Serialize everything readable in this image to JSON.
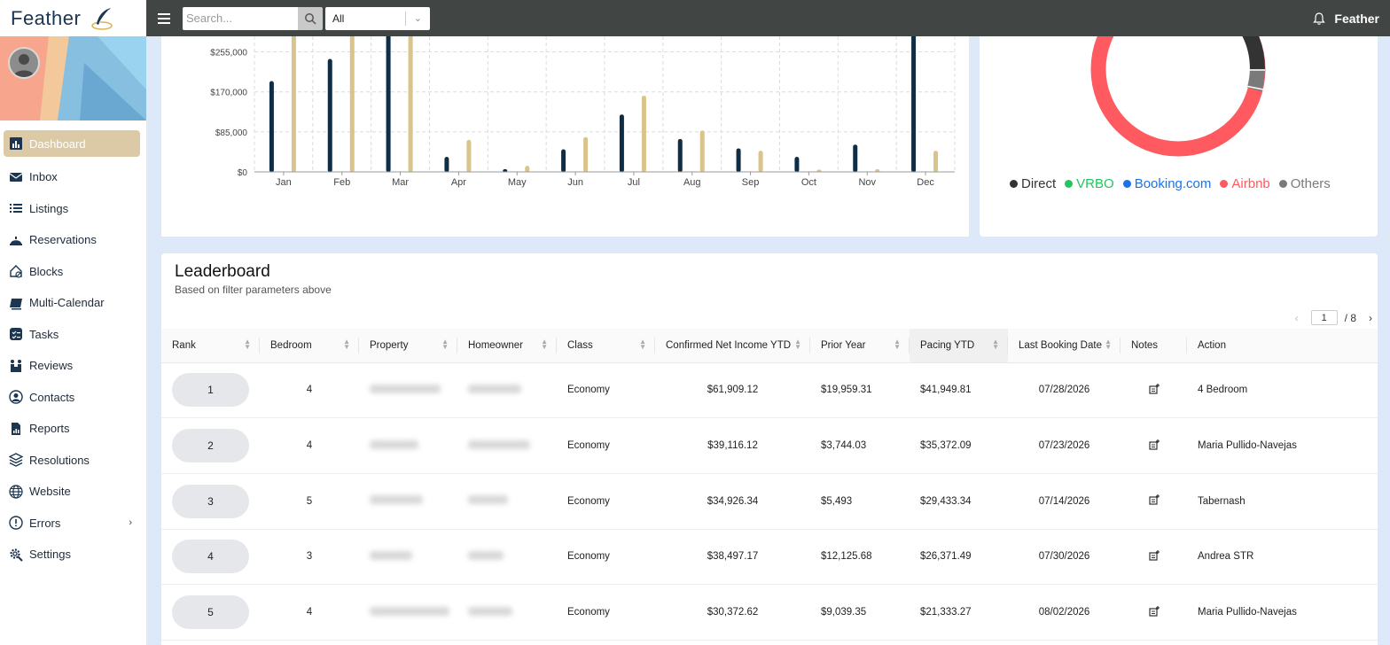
{
  "brand": {
    "name": "Feather"
  },
  "search": {
    "placeholder": "Search...",
    "filter_value": "All"
  },
  "topbar": {
    "user": "Feather"
  },
  "sidebar": {
    "items": [
      {
        "label": "Dashboard",
        "icon": "bar-chart-icon",
        "active": true
      },
      {
        "label": "Inbox",
        "icon": "envelope-icon"
      },
      {
        "label": "Listings",
        "icon": "list-icon"
      },
      {
        "label": "Reservations",
        "icon": "service-bell-icon"
      },
      {
        "label": "Blocks",
        "icon": "house-block-icon"
      },
      {
        "label": "Multi-Calendar",
        "icon": "calendar-icon"
      },
      {
        "label": "Tasks",
        "icon": "tasks-icon"
      },
      {
        "label": "Reviews",
        "icon": "reviews-icon"
      },
      {
        "label": "Contacts",
        "icon": "contact-icon"
      },
      {
        "label": "Reports",
        "icon": "report-icon"
      },
      {
        "label": "Resolutions",
        "icon": "layers-icon"
      },
      {
        "label": "Website",
        "icon": "globe-icon"
      },
      {
        "label": "Errors",
        "icon": "alert-circle-icon",
        "expandable": true
      },
      {
        "label": "Settings",
        "icon": "gear-icon"
      }
    ]
  },
  "chart_data": {
    "type": "bar",
    "categories": [
      "Jan",
      "Feb",
      "Mar",
      "Apr",
      "May",
      "Jun",
      "Jul",
      "Aug",
      "Sep",
      "Oct",
      "Nov",
      "Dec"
    ],
    "series": [
      {
        "values": [
          193000,
          240000,
          295000,
          32000,
          6000,
          48000,
          122000,
          70000,
          50000,
          32000,
          58000,
          297000
        ],
        "color": "#0f2d45"
      },
      {
        "values": [
          322000,
          315000,
          340000,
          68000,
          13000,
          74000,
          162000,
          88000,
          45000,
          5000,
          6000,
          45000
        ],
        "color": "#d9c48c"
      }
    ],
    "ylim": [
      0,
      320000
    ],
    "yticks": [
      0,
      85000,
      170000,
      255000
    ],
    "ytick_labels": [
      "$0",
      "$85,000",
      "$170,000",
      "$255,000"
    ],
    "grid": true
  },
  "donut": {
    "legend": [
      {
        "label": "Direct",
        "color": "#333333"
      },
      {
        "label": "VRBO",
        "color": "#22c55e"
      },
      {
        "label": "Booking.com",
        "color": "#1a73e8"
      },
      {
        "label": "Airbnb",
        "color": "#ff5a5f"
      },
      {
        "label": "Others",
        "color": "#7a7a7a"
      }
    ]
  },
  "leaderboard": {
    "title": "Leaderboard",
    "subtitle": "Based on filter parameters above",
    "pagination": {
      "current": "1",
      "total": "/ 8"
    },
    "columns": [
      "Rank",
      "Bedroom",
      "Property",
      "Homeowner",
      "Class",
      "Confirmed Net Income YTD",
      "Prior Year",
      "Pacing YTD",
      "Last Booking Date",
      "Notes",
      "Action"
    ],
    "rows": [
      {
        "rank": "1",
        "bedroom": "4",
        "class": "Economy",
        "net_income": "$61,909.12",
        "prior_year": "$19,959.31",
        "pacing": "$41,949.81",
        "last_booking": "07/28/2026",
        "action": "4 Bedroom"
      },
      {
        "rank": "2",
        "bedroom": "4",
        "class": "Economy",
        "net_income": "$39,116.12",
        "prior_year": "$3,744.03",
        "pacing": "$35,372.09",
        "last_booking": "07/23/2026",
        "action": "Maria Pullido-Navejas"
      },
      {
        "rank": "3",
        "bedroom": "5",
        "class": "Economy",
        "net_income": "$34,926.34",
        "prior_year": "$5,493",
        "pacing": "$29,433.34",
        "last_booking": "07/14/2026",
        "action": "Tabernash"
      },
      {
        "rank": "4",
        "bedroom": "3",
        "class": "Economy",
        "net_income": "$38,497.17",
        "prior_year": "$12,125.68",
        "pacing": "$26,371.49",
        "last_booking": "07/30/2026",
        "action": "Andrea STR"
      },
      {
        "rank": "5",
        "bedroom": "4",
        "class": "Economy",
        "net_income": "$30,372.62",
        "prior_year": "$9,039.35",
        "pacing": "$21,333.27",
        "last_booking": "08/02/2026",
        "action": "Maria Pullido-Navejas"
      }
    ]
  }
}
